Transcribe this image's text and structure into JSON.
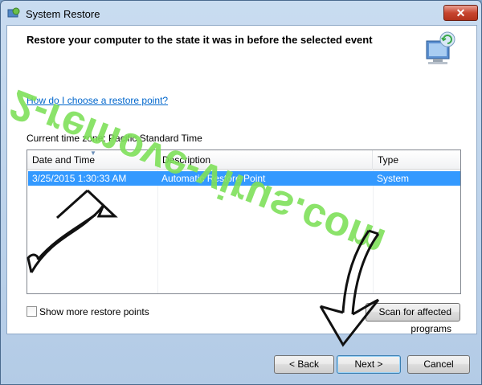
{
  "window": {
    "title": "System Restore"
  },
  "header": {
    "text": "Restore your computer to the state it was in before the selected event"
  },
  "help": {
    "link_text": "How do I choose a restore point?"
  },
  "timezone": {
    "text": "Current time zone: Pacific Standard Time"
  },
  "table": {
    "columns": [
      "Date and Time",
      "Description",
      "Type"
    ],
    "rows": [
      {
        "date": "3/25/2015 1:30:33 AM",
        "description": "Automatic Restore Point",
        "type": "System"
      }
    ]
  },
  "options": {
    "show_more_label": "Show more restore points"
  },
  "buttons": {
    "scan": "Scan for affected programs",
    "back": "< Back",
    "next": "Next >",
    "cancel": "Cancel"
  },
  "watermark": {
    "text": "2-remove-virus.com"
  },
  "colors": {
    "selection": "#3399ff",
    "link": "#0066cc",
    "watermark": "#7ee05a"
  }
}
